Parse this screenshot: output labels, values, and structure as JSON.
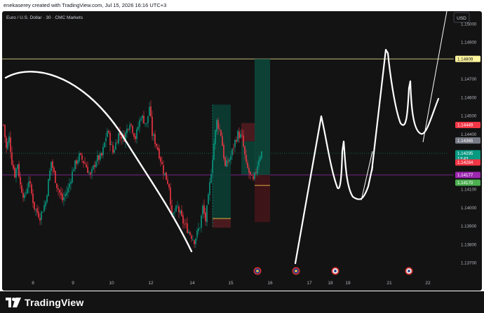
{
  "header": {
    "attribution": "enekaserey created with TradingView.com, Jul 15, 2026 16:16 UTC+3"
  },
  "chart_data": {
    "type": "candlestick",
    "title": "Euro / U.S. Dollar · 30 · CMC Markets",
    "currency": "USD",
    "y_axis": {
      "ylim": [
        1.1365,
        1.1505
      ],
      "ticks": [
        "1.15000",
        "1.14900",
        "1.14700",
        "1.14600",
        "1.14500",
        "1.14400",
        "1.14100",
        "1.14000",
        "1.13900",
        "1.13800",
        "1.13700"
      ],
      "tick_values": [
        1.15,
        1.149,
        1.147,
        1.146,
        1.145,
        1.144,
        1.141,
        1.14,
        1.139,
        1.138,
        1.137
      ]
    },
    "x_axis": {
      "labels": [
        "8",
        "9",
        "10",
        "12",
        "14",
        "15",
        "16",
        "17",
        "18",
        "19",
        "21",
        "22"
      ]
    },
    "price_labels": [
      {
        "text": "1.14809",
        "value": 1.14809,
        "color": "#fff59d",
        "text_color": "#131722"
      },
      {
        "text": "1.14449",
        "value": 1.14449,
        "color": "#f23645",
        "text_color": "#ffffff"
      },
      {
        "text": "1.14365",
        "value": 1.14365,
        "color": "#787b86",
        "text_color": "#ffffff"
      },
      {
        "text": "1.14295",
        "value": 1.14295,
        "color": "#089981",
        "text_color": "#ffffff",
        "sub": "13:43"
      },
      {
        "text": "1.14284",
        "value": 1.14245,
        "color": "#f23645",
        "text_color": "#ffffff"
      },
      {
        "text": "1.14177",
        "value": 1.14177,
        "color": "#9c27b0",
        "text_color": "#ffffff"
      },
      {
        "text": "1.14170",
        "value": 1.14135,
        "color": "#4caf50",
        "text_color": "#ffffff"
      }
    ],
    "horizontal_lines": [
      {
        "value": 1.14809,
        "color": "#fff59d"
      },
      {
        "value": 1.14177,
        "color": "#9c27b0"
      }
    ],
    "candle_path": [
      [
        0,
        1.1445
      ],
      [
        2,
        1.1432
      ],
      [
        4,
        1.1438
      ],
      [
        6,
        1.1425
      ],
      [
        8,
        1.1418
      ],
      [
        10,
        1.1424
      ],
      [
        12,
        1.1412
      ],
      [
        15,
        1.1405
      ],
      [
        18,
        1.1415
      ],
      [
        22,
        1.14
      ],
      [
        26,
        1.1395
      ],
      [
        30,
        1.1403
      ],
      [
        34,
        1.1425
      ],
      [
        38,
        1.1412
      ],
      [
        42,
        1.1404
      ],
      [
        46,
        1.141
      ],
      [
        50,
        1.1422
      ],
      [
        54,
        1.1428
      ],
      [
        58,
        1.1424
      ],
      [
        62,
        1.1417
      ],
      [
        66,
        1.1426
      ],
      [
        70,
        1.1428
      ],
      [
        74,
        1.1442
      ],
      [
        78,
        1.143
      ],
      [
        82,
        1.144
      ],
      [
        86,
        1.1438
      ],
      [
        90,
        1.1447
      ],
      [
        94,
        1.1438
      ],
      [
        98,
        1.145
      ],
      [
        102,
        1.1445
      ],
      [
        104,
        1.1455
      ],
      [
        106,
        1.144
      ],
      [
        110,
        1.1432
      ],
      [
        114,
        1.142
      ],
      [
        118,
        1.1412
      ],
      [
        120,
        1.1395
      ],
      [
        124,
        1.14
      ],
      [
        128,
        1.1392
      ],
      [
        132,
        1.1387
      ],
      [
        136,
        1.1382
      ],
      [
        140,
        1.139
      ],
      [
        142,
        1.14
      ],
      [
        144,
        1.1393
      ],
      [
        146,
        1.1405
      ],
      [
        150,
        1.1435
      ],
      [
        152,
        1.1447
      ],
      [
        155,
        1.144
      ],
      [
        158,
        1.1422
      ],
      [
        162,
        1.1428
      ],
      [
        165,
        1.1436
      ],
      [
        167,
        1.144
      ],
      [
        170,
        1.1438
      ],
      [
        173,
        1.1423
      ],
      [
        176,
        1.1417
      ],
      [
        178,
        1.1414
      ],
      [
        180,
        1.142
      ],
      [
        182,
        1.1427
      ],
      [
        184,
        1.143
      ]
    ],
    "drawings": [
      {
        "kind": "arc-curve",
        "color": "#ffffff"
      },
      {
        "kind": "projection-path",
        "color": "#ffffff"
      },
      {
        "kind": "position-long",
        "entry": 1.14177,
        "target": 1.14809,
        "stop": 1.1394
      },
      {
        "kind": "position-short",
        "entry": 1.1436,
        "target": 1.1398,
        "stop": 1.1441
      }
    ],
    "events": [
      "eu-flag-event",
      "eu-flag-event",
      "us-flag-event",
      "us-flag-event"
    ],
    "grid": false,
    "legend": "none"
  },
  "footer": {
    "brand": "TradingView"
  },
  "colors": {
    "background": "#131313",
    "bull": "#089981",
    "bear": "#f23645",
    "axis_text": "#b2b5be",
    "drawing": "#ffffff"
  }
}
